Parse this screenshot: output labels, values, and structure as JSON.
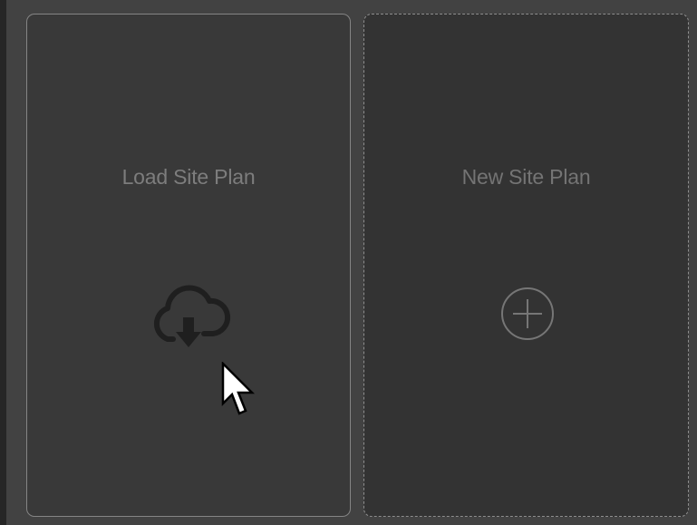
{
  "cards": {
    "load": {
      "label": "Load Site Plan",
      "icon": "cloud-download-icon"
    },
    "new": {
      "label": "New Site Plan",
      "icon": "plus-circle-icon"
    }
  },
  "cursor": {
    "icon": "mouse-pointer-icon"
  },
  "colors": {
    "background": "#424242",
    "load_card_bg": "#393939",
    "new_card_bg": "#333333",
    "text": "#7d7d7d",
    "icon_dark": "#1f1f1f",
    "icon_light": "#767676"
  }
}
